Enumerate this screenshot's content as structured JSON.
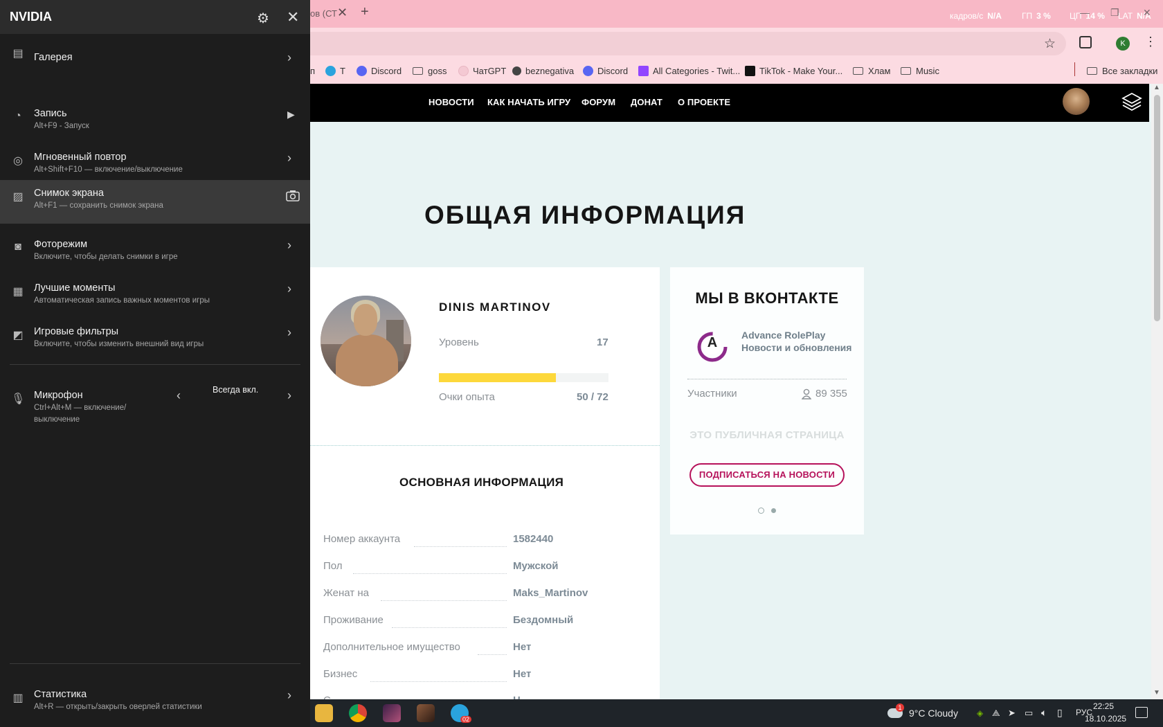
{
  "browser": {
    "tab_title_fragment": "ов (СТ",
    "bookmarks": [
      {
        "label": "п",
        "icon": "none"
      },
      {
        "label": "Т",
        "icon": "telegram-icon"
      },
      {
        "label": "Discord",
        "icon": "discord-icon"
      },
      {
        "label": "goss",
        "icon": "folder-icon"
      },
      {
        "label": "ЧатGPT",
        "icon": "chatgpt-icon"
      },
      {
        "label": "beznegativa",
        "icon": "site-icon"
      },
      {
        "label": "Discord",
        "icon": "discord-icon"
      },
      {
        "label": "All Categories - Twit...",
        "icon": "twitch-icon"
      },
      {
        "label": "TikTok - Make Your...",
        "icon": "tiktok-icon"
      },
      {
        "label": "Хлам",
        "icon": "folder-icon"
      },
      {
        "label": "Music",
        "icon": "folder-icon"
      }
    ],
    "all_bookmarks": "Все закладки",
    "account_initial": "K",
    "colors": {
      "tabbar": "#f8b8c6",
      "toolbar": "#fcdbe2"
    }
  },
  "stats_overlay": {
    "fps_label": "кадров/с",
    "fps_value": "N/A",
    "gpu_label": "ГП",
    "gpu_value": "3 %",
    "cpu_label": "ЦП",
    "cpu_value": "14 %",
    "lat_label": "LAT",
    "lat_value": "N/A"
  },
  "site": {
    "nav": [
      "НОВОСТИ",
      "КАК НАЧАТЬ ИГРУ",
      "ФОРУМ",
      "ДОНАТ",
      "О ПРОЕКТЕ"
    ],
    "page_title": "ОБЩАЯ ИНФОРМАЦИЯ",
    "profile": {
      "name": "DINIS MARTINOV",
      "level_label": "Уровень",
      "level_value": "17",
      "xp_label": "Очки опыта",
      "xp_value": "50 / 72",
      "xp_progress": 0.69
    },
    "basic_info": {
      "title": "ОСНОВНАЯ ИНФОРМАЦИЯ",
      "rows": [
        {
          "label": "Номер аккаунта",
          "value": "1582440"
        },
        {
          "label": "Пол",
          "value": "Мужской"
        },
        {
          "label": "Женат на",
          "value": "Maks_Martinov"
        },
        {
          "label": "Проживание",
          "value": "Бездомный"
        },
        {
          "label": "Дополнительное имущество",
          "value": "Нет"
        },
        {
          "label": "Бизнес",
          "value": "Нет"
        },
        {
          "label": "С...",
          "value": "Н..."
        }
      ]
    },
    "vk": {
      "title": "МЫ В ВКОНТАКТЕ",
      "logo_letter": "A",
      "group_name": "Advance RolePlay",
      "group_desc": "Новости и обновления",
      "members_label": "Участники",
      "members_count": "89 355",
      "public_note": "ЭТО ПУБЛИЧНАЯ СТРАНИЦА",
      "subscribe": "ПОДПИСАТЬСЯ НА НОВОСТИ"
    }
  },
  "nvidia": {
    "title": "NVIDIA",
    "items": [
      {
        "title": "Галерея",
        "sub": "",
        "icon": "gallery-icon",
        "action": "›"
      },
      {
        "title": "Запись",
        "sub": "Alt+F9 - Запуск",
        "icon": "record-icon",
        "action": "▶"
      },
      {
        "title": "Мгновенный повтор",
        "sub": "Alt+Shift+F10 — включение/выключение",
        "icon": "instant-replay-icon",
        "action": "›"
      },
      {
        "title": "Снимок экрана",
        "sub": "Alt+F1 — сохранить снимок экрана",
        "icon": "screenshot-icon",
        "action": "camera"
      },
      {
        "title": "Фоторежим",
        "sub": "Включите, чтобы делать снимки в игре",
        "icon": "photo-mode-icon",
        "action": "›"
      },
      {
        "title": "Лучшие моменты",
        "sub": "Автоматическая запись важных моментов игры",
        "icon": "highlights-icon",
        "action": "›"
      },
      {
        "title": "Игровые фильтры",
        "sub": "Включите, чтобы изменить внешний вид игры",
        "icon": "game-filter-icon",
        "action": "›"
      }
    ],
    "mic": {
      "title": "Микрофон",
      "sub_line1": "Ctrl+Alt+M — включение/",
      "sub_line2": "выключение",
      "mode": "Всегда вкл."
    },
    "stats": {
      "title": "Статистика",
      "sub": "Alt+R — открыть/закрыть оверлей статистики"
    }
  },
  "taskbar": {
    "weather": "9°C  Cloudy",
    "lang": "РУС",
    "time": "22:25",
    "date": "18.10.2025",
    "weather_badge": "1",
    "telegram_badge": "02"
  }
}
